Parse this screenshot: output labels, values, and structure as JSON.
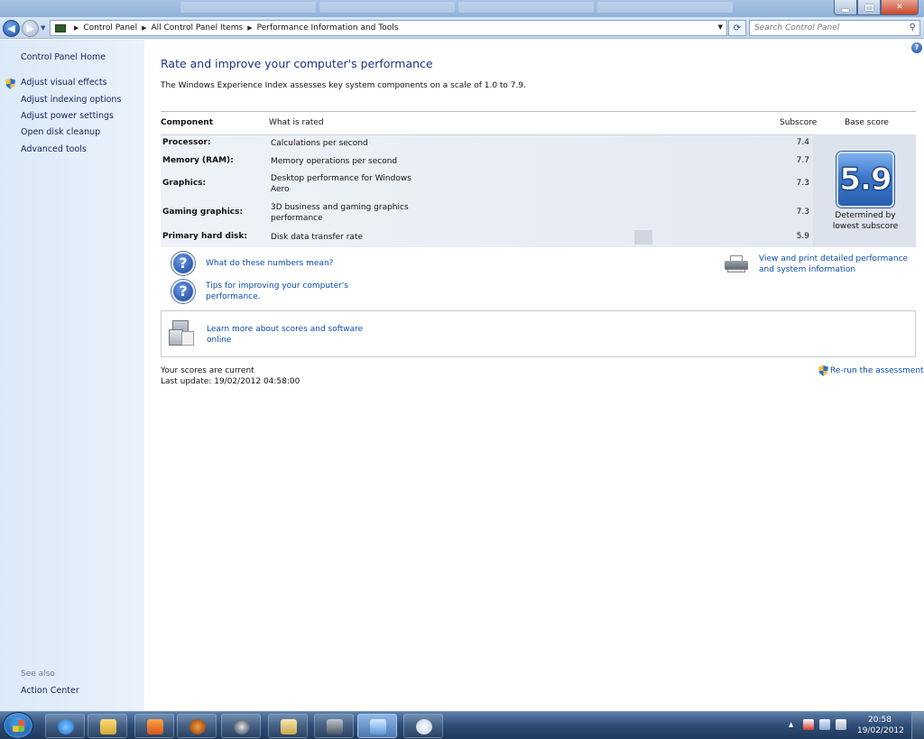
{
  "window": {
    "minimize_glyph": "",
    "maximize_glyph": "",
    "close_glyph": "✕"
  },
  "address_bar": {
    "breadcrumbs": [
      "Control Panel",
      "All Control Panel Items",
      "Performance Information and Tools"
    ],
    "search_placeholder": "Search Control Panel"
  },
  "sidebar": {
    "home": "Control Panel Home",
    "links": [
      "Adjust visual effects",
      "Adjust indexing options",
      "Adjust power settings",
      "Open disk cleanup",
      "Advanced tools"
    ],
    "see_also_label": "See also",
    "see_also_links": [
      "Action Center"
    ]
  },
  "main": {
    "heading": "Rate and improve your computer's performance",
    "intro": "The Windows Experience Index assesses key system components on a scale of 1.0 to 7.9.",
    "table": {
      "headers": {
        "component": "Component",
        "what_is_rated": "What is rated",
        "subscore": "Subscore",
        "base_score": "Base score"
      },
      "rows": [
        {
          "component": "Processor:",
          "desc": "Calculations per second",
          "subscore": "7.4"
        },
        {
          "component": "Memory (RAM):",
          "desc": "Memory operations per second",
          "subscore": "7.7"
        },
        {
          "component": "Graphics:",
          "desc": "Desktop performance for Windows Aero",
          "subscore": "7.3"
        },
        {
          "component": "Gaming graphics:",
          "desc": "3D business and gaming graphics performance",
          "subscore": "7.3"
        },
        {
          "component": "Primary hard disk:",
          "desc": "Disk data transfer rate",
          "subscore": "5.9"
        }
      ],
      "base_score": "5.9",
      "base_note": "Determined by lowest subscore"
    },
    "links": {
      "numbers_mean": "What do these numbers mean?",
      "tips": "Tips for improving your computer's performance.",
      "print": "View and print detailed performance and system information",
      "learn_more": "Learn more about scores and software online"
    },
    "status": {
      "current": "Your scores are current",
      "last_update": "Last update: 19/02/2012 04:58:00",
      "rerun": "Re-run the assessment"
    }
  },
  "taskbar": {
    "clock_time": "20:58",
    "clock_date": "19/02/2012",
    "tray_show_glyph": "▲"
  }
}
